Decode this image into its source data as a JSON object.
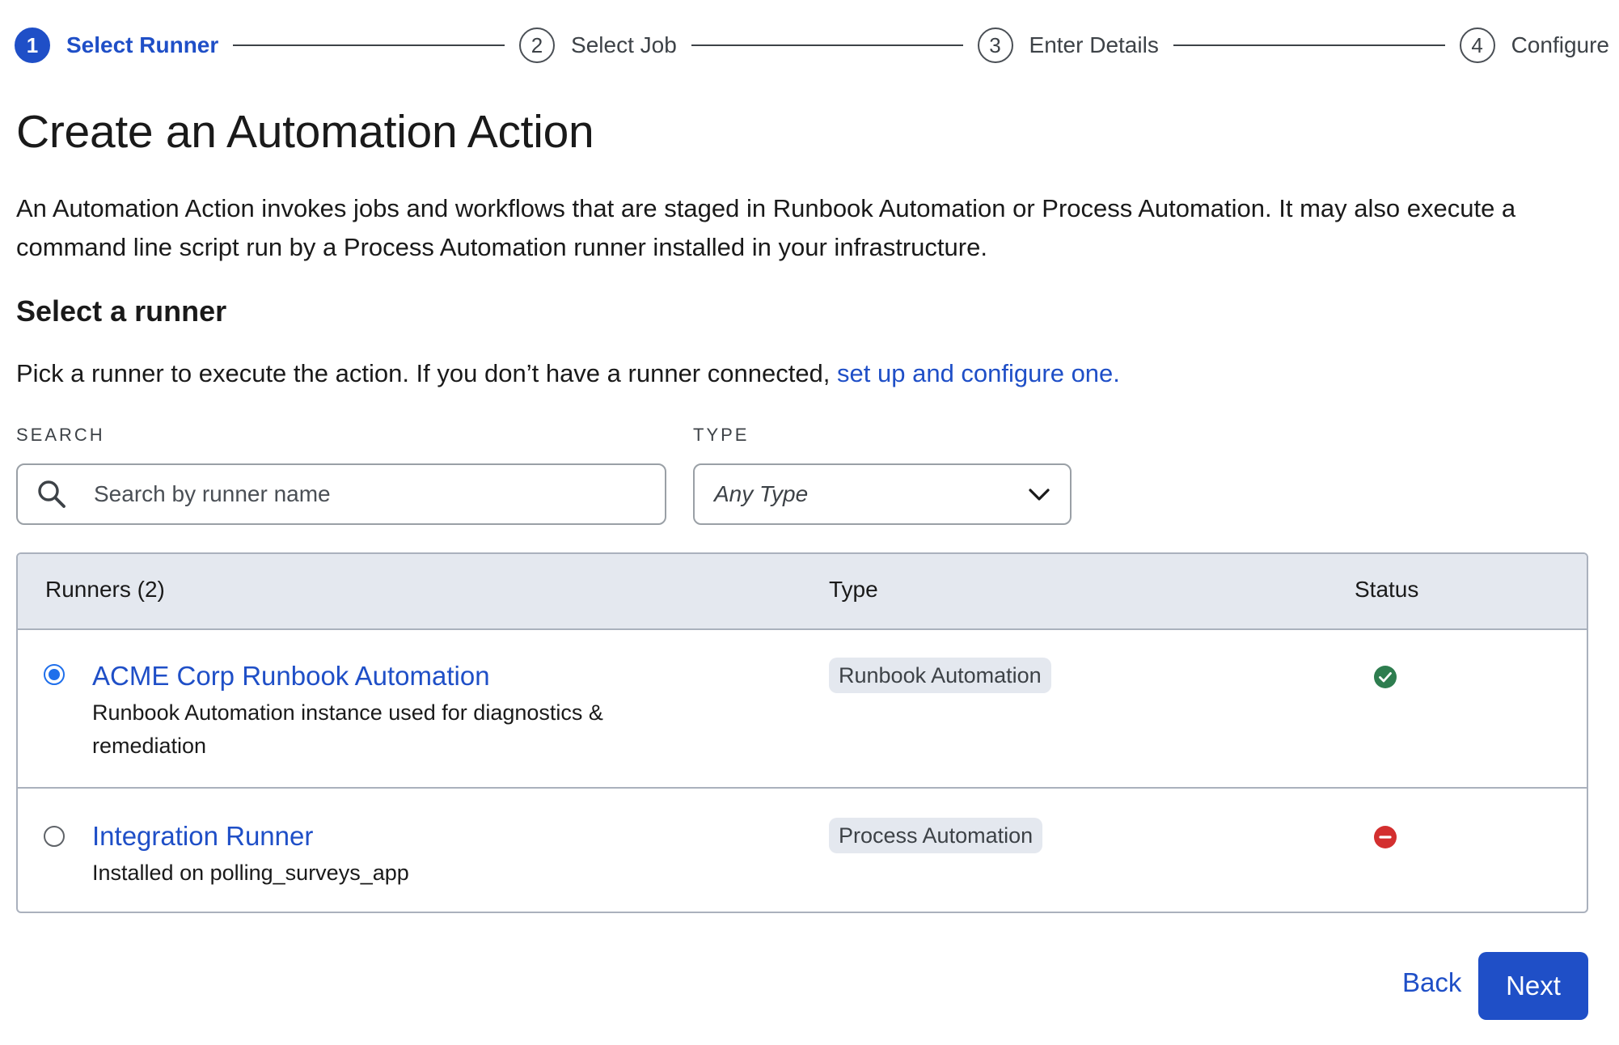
{
  "stepper": {
    "steps": [
      {
        "number": "1",
        "label": "Select Runner",
        "active": true
      },
      {
        "number": "2",
        "label": "Select Job",
        "active": false
      },
      {
        "number": "3",
        "label": "Enter Details",
        "active": false
      },
      {
        "number": "4",
        "label": "Configure",
        "active": false
      }
    ]
  },
  "page": {
    "title": "Create an Automation Action",
    "intro": "An Automation Action invokes jobs and workflows that are staged in Runbook Automation or Process Automation. It may also execute a command line script run by a Process Automation runner installed in your infrastructure."
  },
  "section": {
    "title": "Select a runner",
    "desc_text": "Pick a runner to execute the action. If you don’t have a runner connected, ",
    "desc_link": "set up and configure one."
  },
  "filters": {
    "search_label": "SEARCH",
    "search_placeholder": "Search by runner name",
    "search_value": "",
    "type_label": "TYPE",
    "type_value": "Any Type"
  },
  "table": {
    "columns": {
      "runners": "Runners (2)",
      "type": "Type",
      "status": "Status"
    },
    "rows": [
      {
        "name": "ACME Corp Runbook Automation",
        "description": "Runbook Automation instance used for diagnostics & remediation",
        "type": "Runbook Automation",
        "status": "ok",
        "selected": true
      },
      {
        "name": "Integration Runner",
        "description": "Installed on polling_surveys_app",
        "type": "Process Automation",
        "status": "error",
        "selected": false
      }
    ]
  },
  "actions": {
    "back_label": "Back",
    "next_label": "Next"
  },
  "colors": {
    "accent": "#1f4fc7",
    "radio_selected": "#1f6feb",
    "status_ok": "#2e7d4f",
    "status_error": "#d32f2f",
    "header_bg": "#e4e8ef",
    "badge_bg": "#e4e8ef"
  },
  "icons": {
    "search": "search-icon",
    "select": "chevron-down-icon",
    "status_ok": "check-circle-icon",
    "status_error": "minus-circle-icon"
  }
}
